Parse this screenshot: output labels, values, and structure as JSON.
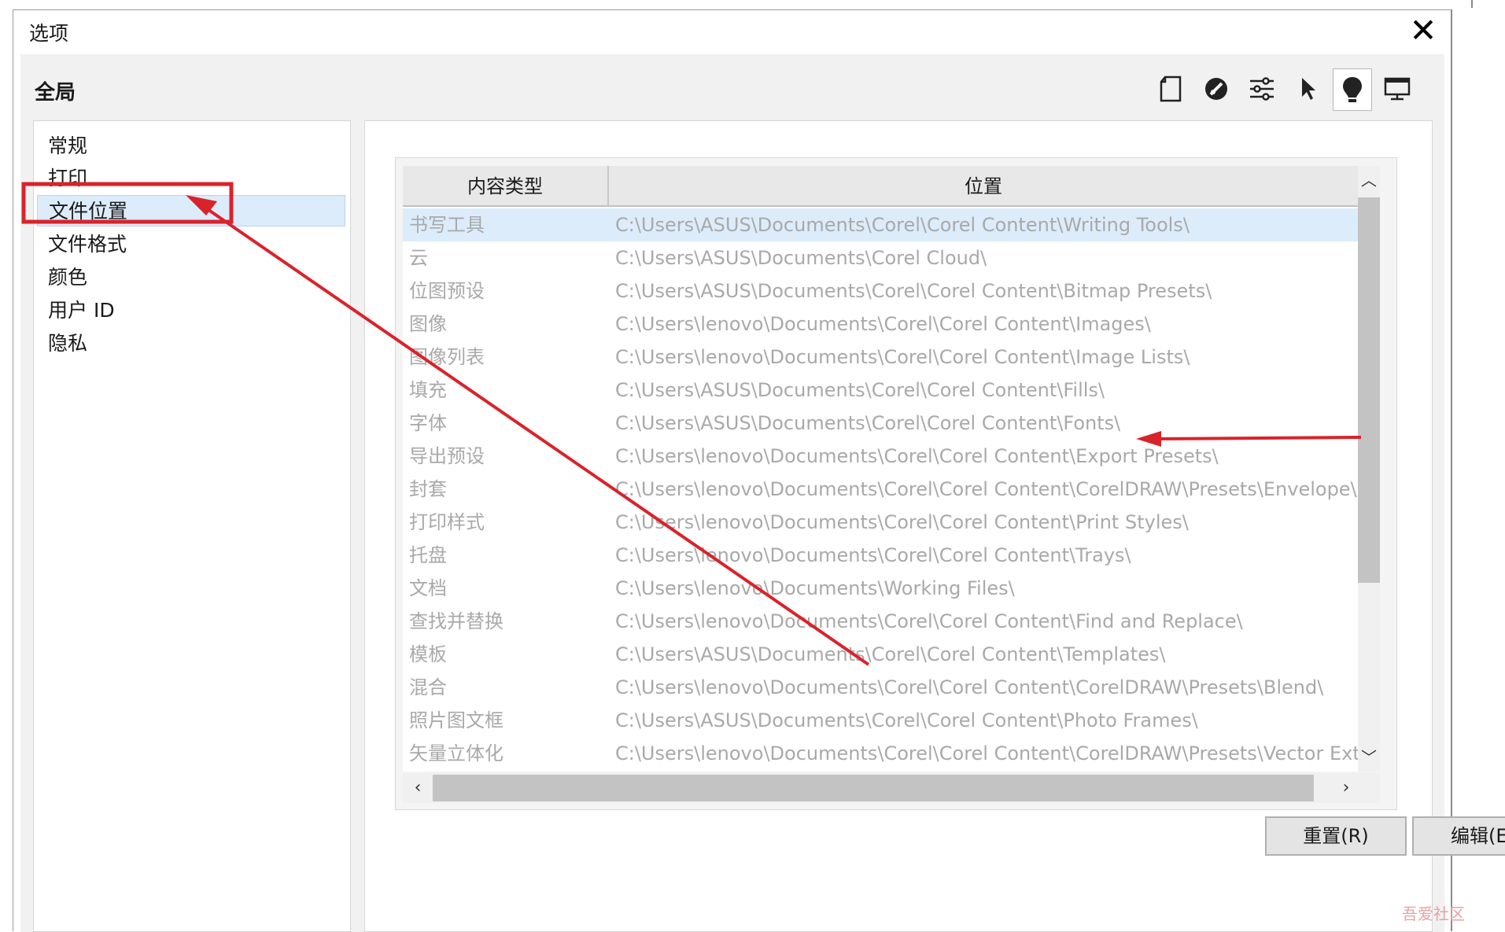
{
  "window": {
    "title": "选项",
    "close_icon": "close-icon"
  },
  "section_title": "全局",
  "toolbar": {
    "icons": [
      "document-icon",
      "color-disc-icon",
      "sliders-icon",
      "pointer-icon",
      "lightbulb-icon",
      "monitor-icon"
    ],
    "active_index": 4
  },
  "sidebar": {
    "items": [
      {
        "label": "常规"
      },
      {
        "label": "打印"
      },
      {
        "label": "文件位置"
      },
      {
        "label": "文件格式"
      },
      {
        "label": "颜色"
      },
      {
        "label": "用户 ID"
      },
      {
        "label": "隐私"
      }
    ],
    "selected_index": 2
  },
  "table": {
    "columns": [
      "内容类型",
      "位置"
    ],
    "rows": [
      {
        "type": "书写工具",
        "path": "C:\\Users\\ASUS\\Documents\\Corel\\Corel Content\\Writing Tools\\"
      },
      {
        "type": "云",
        "path": "C:\\Users\\ASUS\\Documents\\Corel Cloud\\"
      },
      {
        "type": "位图预设",
        "path": "C:\\Users\\ASUS\\Documents\\Corel\\Corel Content\\Bitmap Presets\\"
      },
      {
        "type": "图像",
        "path": "C:\\Users\\lenovo\\Documents\\Corel\\Corel Content\\Images\\"
      },
      {
        "type": "图像列表",
        "path": "C:\\Users\\lenovo\\Documents\\Corel\\Corel Content\\Image Lists\\"
      },
      {
        "type": "填充",
        "path": "C:\\Users\\ASUS\\Documents\\Corel\\Corel Content\\Fills\\"
      },
      {
        "type": "字体",
        "path": "C:\\Users\\ASUS\\Documents\\Corel\\Corel Content\\Fonts\\"
      },
      {
        "type": "导出预设",
        "path": "C:\\Users\\lenovo\\Documents\\Corel\\Corel Content\\Export Presets\\"
      },
      {
        "type": "封套",
        "path": "C:\\Users\\lenovo\\Documents\\Corel\\Corel Content\\CorelDRAW\\Presets\\Envelope\\"
      },
      {
        "type": "打印样式",
        "path": "C:\\Users\\lenovo\\Documents\\Corel\\Corel Content\\Print Styles\\"
      },
      {
        "type": "托盘",
        "path": "C:\\Users\\lenovo\\Documents\\Corel\\Corel Content\\Trays\\"
      },
      {
        "type": "文档",
        "path": "C:\\Users\\lenovo\\Documents\\Working Files\\"
      },
      {
        "type": "查找并替换",
        "path": "C:\\Users\\lenovo\\Documents\\Corel\\Corel Content\\Find and Replace\\"
      },
      {
        "type": "模板",
        "path": "C:\\Users\\ASUS\\Documents\\Corel\\Corel Content\\Templates\\"
      },
      {
        "type": "混合",
        "path": "C:\\Users\\lenovo\\Documents\\Corel\\Corel Content\\CorelDRAW\\Presets\\Blend\\"
      },
      {
        "type": "照片图文框",
        "path": "C:\\Users\\ASUS\\Documents\\Corel\\Corel Content\\Photo Frames\\"
      },
      {
        "type": "矢量立体化",
        "path": "C:\\Users\\lenovo\\Documents\\Corel\\Corel Content\\CorelDRAW\\Presets\\Vector Extrude\\"
      }
    ],
    "selected_index": 0
  },
  "buttons": {
    "reset": "重置(R)",
    "edit": "编辑(E)"
  },
  "watermark": "吾爱社区",
  "colors": {
    "annotation_red": "#d9232a",
    "selection_blue": "#dcecfb",
    "muted_text": "#a9a9a9"
  }
}
